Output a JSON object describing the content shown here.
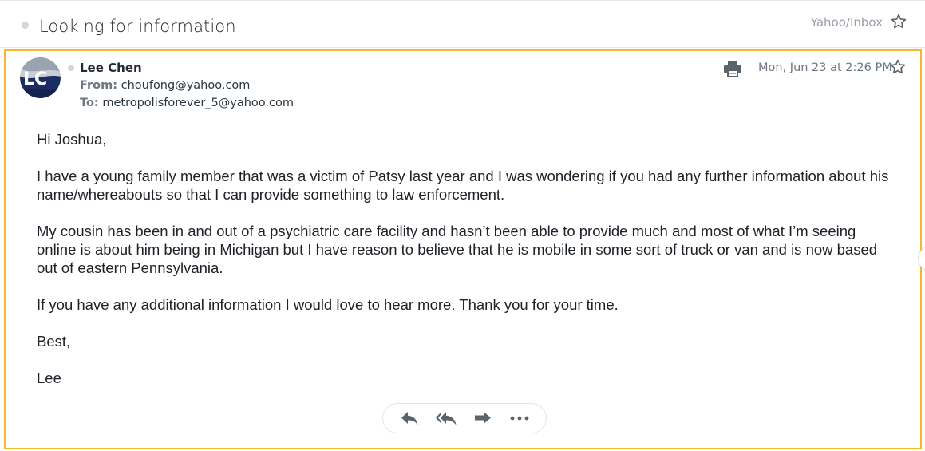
{
  "subject": {
    "title": "Looking for information",
    "folder": "Yahoo/Inbox"
  },
  "message": {
    "avatar": {
      "initials": "LC"
    },
    "sender_name": "Lee Chen",
    "from_label": "From:",
    "from_address": "choufong@yahoo.com",
    "to_label": "To:",
    "to_address": "metropolisforever_5@yahoo.com",
    "date": "Mon, Jun 23 at 2:26 PM",
    "body": {
      "greeting": "Hi Joshua,",
      "paragraph1": "I have a young family member that was a victim of Patsy last year and I was wondering if you had any further information about his name/whereabouts so that I can provide something to law enforcement.",
      "paragraph2": "My cousin has been in and out of a psychiatric care facility and hasn’t been able to provide much and most of what I’m seeing online is about him being in Michigan but I have reason to believe that he is mobile in some sort of truck or van and is now based out of eastern Pennsylvania.",
      "paragraph3": "If you have any additional information I would love to hear more. Thank you for your time.",
      "closing": "Best,",
      "signature": "Lee"
    }
  },
  "icons": {
    "star": "star-outline-icon",
    "print": "printer-icon",
    "reply": "reply-icon",
    "reply_all": "reply-all-icon",
    "forward": "forward-icon",
    "more": "more-horizontal-icon"
  },
  "colors": {
    "focus_border": "#f5b731",
    "icon_gray": "#5b636a",
    "text_dark": "#1d2228",
    "muted": "#6e7780"
  }
}
